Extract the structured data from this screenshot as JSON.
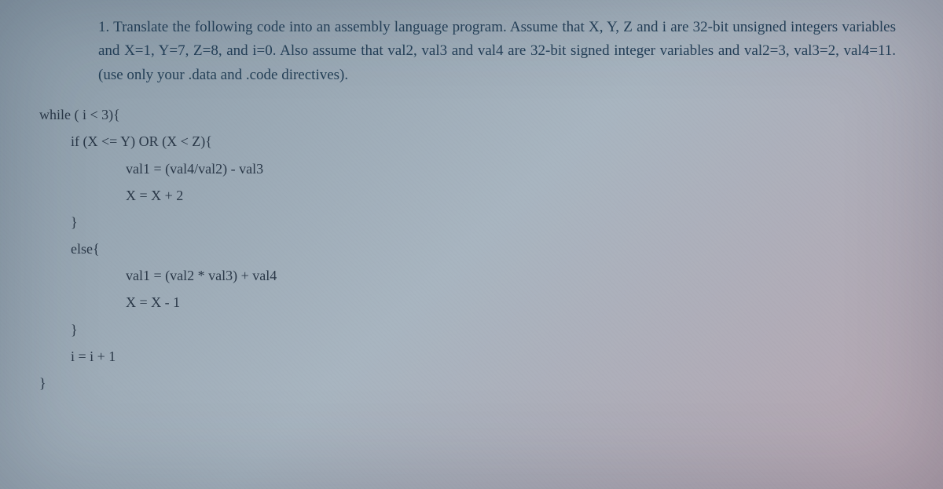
{
  "problem": {
    "number": "1.",
    "text": "Translate the following code into an assembly language program. Assume that X, Y, Z and i are 32-bit unsigned integers variables and X=1, Y=7, Z=8, and i=0.  Also assume that val2, val3 and val4 are 32-bit signed integer variables and val2=3, val3=2, val4=11. (use only your .data and .code directives)."
  },
  "code": {
    "lines": [
      {
        "indent": 0,
        "text": "while ( i < 3){"
      },
      {
        "indent": 1,
        "text": "if (X <= Y) OR (X < Z){"
      },
      {
        "indent": 2,
        "text": "val1 = (val4/val2) - val3"
      },
      {
        "indent": 2,
        "text": "X = X + 2"
      },
      {
        "indent": 1,
        "text": "}"
      },
      {
        "indent": 1,
        "text": "else{"
      },
      {
        "indent": 2,
        "text": "val1 = (val2 * val3) + val4"
      },
      {
        "indent": 2,
        "text": "X = X - 1"
      },
      {
        "indent": 1,
        "text": "}"
      },
      {
        "indent": 1,
        "text": "i = i + 1"
      },
      {
        "indent": 0,
        "text": "}"
      }
    ]
  }
}
